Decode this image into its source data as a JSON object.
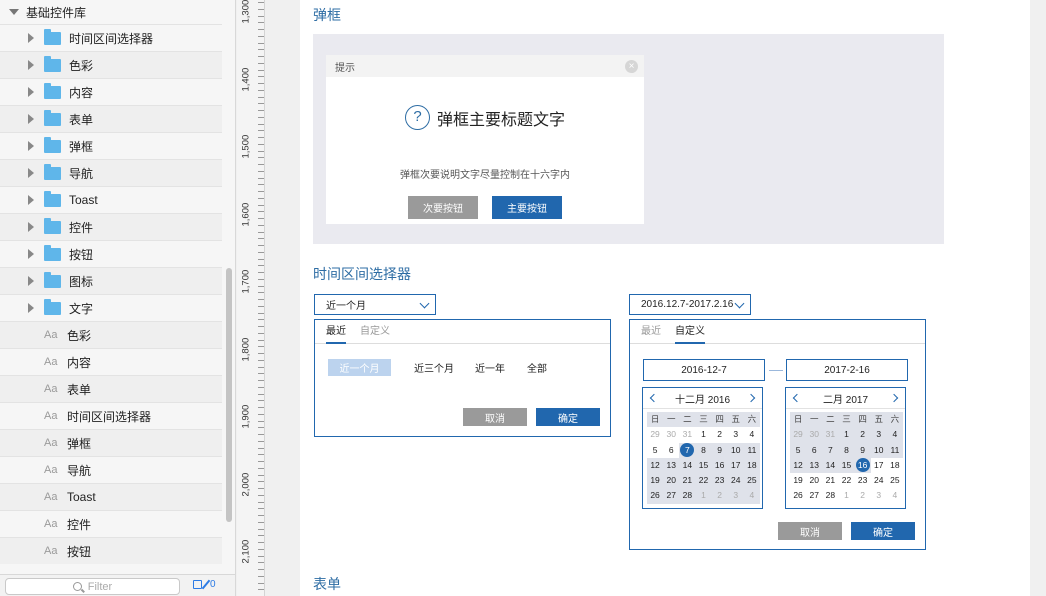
{
  "sidebar": {
    "title": "基础控件库",
    "folders": [
      "时间区间选择器",
      "色彩",
      "内容",
      "表单",
      "弹框",
      "导航",
      "Toast",
      "控件",
      "按钮",
      "图标",
      "文字"
    ],
    "text_styles": [
      "色彩",
      "内容",
      "表单",
      "时间区间选择器",
      "弹框",
      "导航",
      "Toast",
      "控件",
      "按钮"
    ],
    "text_style_prefix": "Aa",
    "filter_placeholder": "Filter",
    "filter_count": "0"
  },
  "ruler": {
    "labels": [
      "1,300",
      "1,400",
      "1,500",
      "1,600",
      "1,700",
      "1,800",
      "1,900",
      "2,000",
      "2,100"
    ]
  },
  "dialog_section": {
    "title": "弹框",
    "dialog_header": "提示",
    "close_glyph": "×",
    "question_glyph": "?",
    "main_title": "弹框主要标题文字",
    "subtitle": "弹框次要说明文字尽量控制在十六字内",
    "secondary_button": "次要按钮",
    "primary_button": "主要按钮"
  },
  "picker_section": {
    "title": "时间区间选择器",
    "left_picker": {
      "selected": "近一个月",
      "tabs": [
        "最近",
        "自定义"
      ],
      "active_tab": 0,
      "options": [
        "近一个月",
        "近三个月",
        "近一年",
        "全部"
      ],
      "selected_option": 0,
      "cancel": "取消",
      "confirm": "确定"
    },
    "right_picker": {
      "selected": "2016.12.7-2017.2.16",
      "tabs": [
        "最近",
        "自定义"
      ],
      "active_tab": 1,
      "start_date": "2016-12-7",
      "end_date": "2017-2-16",
      "cancel": "取消",
      "confirm": "确定",
      "calendars": [
        {
          "month_label": "十二月 2016",
          "weekdays": [
            "日",
            "一",
            "二",
            "三",
            "四",
            "五",
            "六"
          ],
          "days": [
            "29",
            "30",
            "31",
            "1",
            "2",
            "3",
            "4",
            "5",
            "6",
            "7",
            "8",
            "9",
            "10",
            "11",
            "12",
            "13",
            "14",
            "15",
            "16",
            "17",
            "18",
            "19",
            "20",
            "21",
            "22",
            "23",
            "24",
            "25",
            "26",
            "27",
            "28",
            "1",
            "2",
            "3",
            "4"
          ],
          "dim_days": [
            0,
            1,
            2,
            31,
            32,
            33,
            34
          ],
          "selected_day": 9,
          "range_start": 9,
          "range_end": 34
        },
        {
          "month_label": "二月 2017",
          "weekdays": [
            "日",
            "一",
            "二",
            "三",
            "四",
            "五",
            "六"
          ],
          "days": [
            "29",
            "30",
            "31",
            "1",
            "2",
            "3",
            "4",
            "5",
            "6",
            "7",
            "8",
            "9",
            "10",
            "11",
            "12",
            "13",
            "14",
            "15",
            "16",
            "17",
            "18",
            "19",
            "20",
            "21",
            "22",
            "23",
            "24",
            "25",
            "26",
            "27",
            "28",
            "1",
            "2",
            "3",
            "4"
          ],
          "dim_days": [
            0,
            1,
            2,
            31,
            32,
            33,
            34
          ],
          "selected_day": 18,
          "range_start": 0,
          "range_end": 18
        }
      ]
    }
  },
  "form_section": {
    "title": "表单"
  },
  "colors": {
    "accent": "#2167ae",
    "title_blue": "#2e6da4",
    "folder": "#5fb6ea"
  }
}
